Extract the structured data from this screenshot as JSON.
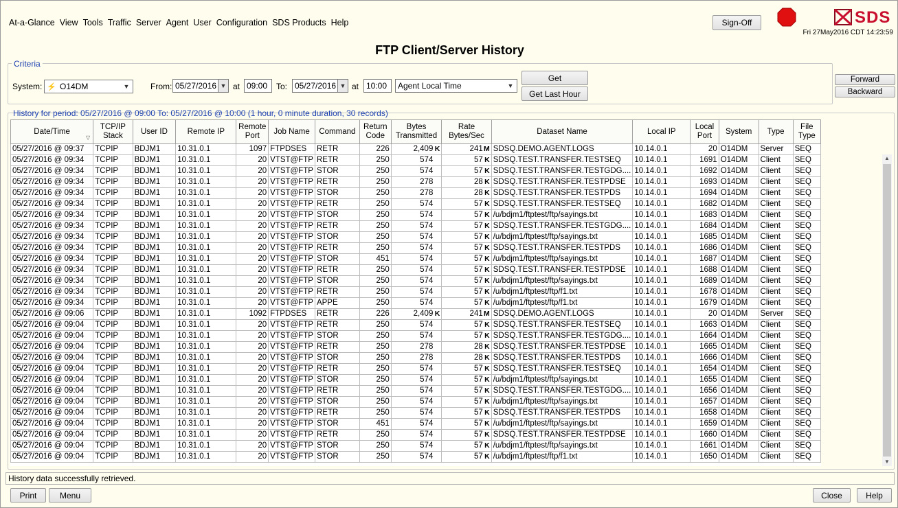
{
  "menu": [
    "At-a-Glance",
    "View",
    "Tools",
    "Traffic",
    "Server",
    "Agent",
    "User",
    "Configuration",
    "SDS Products",
    "Help"
  ],
  "sign_off": "Sign-Off",
  "logo_text": "SDS",
  "datetime": "Fri 27May2016 CDT 14:23:59",
  "page_title": "FTP Client/Server History",
  "criteria": {
    "legend": "Criteria",
    "system_label": "System:",
    "system_value": "O14DM",
    "from_label": "From:",
    "from_date": "05/27/2016",
    "at_label": "at",
    "from_time": "09:00",
    "to_label": "To:",
    "to_date": "05/27/2016",
    "to_time": "10:00",
    "timezone": "Agent Local Time",
    "get": "Get",
    "get_last_hour": "Get Last Hour"
  },
  "forward": "Forward",
  "backward": "Backward",
  "period_text": "History for period: 05/27/2016 @ 09:00 To: 05/27/2016 @ 10:00  (1 hour, 0 minute duration, 30 records)",
  "columns": [
    "Date/Time",
    "TCP/IP Stack",
    "User ID",
    "Remote IP",
    "Remote Port",
    "Job Name",
    "Command",
    "Return Code",
    "Bytes Transmitted",
    "Rate Bytes/Sec",
    "Dataset Name",
    "Local IP",
    "Local Port",
    "System",
    "Type",
    "File Type"
  ],
  "rows": [
    [
      "05/27/2016 @ 09:37",
      "TCPIP",
      "BDJM1",
      "10.31.0.1",
      "1097",
      "FTPDSES",
      "RETR",
      "226",
      "2,409",
      "K",
      "241",
      "M",
      "SDSQ.DEMO.AGENT.LOGS",
      "10.14.0.1",
      "20",
      "O14DM",
      "Server",
      "SEQ"
    ],
    [
      "05/27/2016 @ 09:34",
      "TCPIP",
      "BDJM1",
      "10.31.0.1",
      "20",
      "VTST@FTP",
      "RETR",
      "250",
      "574",
      "",
      "57",
      "K",
      "SDSQ.TEST.TRANSFER.TESTSEQ",
      "10.14.0.1",
      "1691",
      "O14DM",
      "Client",
      "SEQ"
    ],
    [
      "05/27/2016 @ 09:34",
      "TCPIP",
      "BDJM1",
      "10.31.0.1",
      "20",
      "VTST@FTP",
      "STOR",
      "250",
      "574",
      "",
      "57",
      "K",
      "SDSQ.TEST.TRANSFER.TESTGDG....",
      "10.14.0.1",
      "1692",
      "O14DM",
      "Client",
      "SEQ"
    ],
    [
      "05/27/2016 @ 09:34",
      "TCPIP",
      "BDJM1",
      "10.31.0.1",
      "20",
      "VTST@FTP",
      "RETR",
      "250",
      "278",
      "",
      "28",
      "K",
      "SDSQ.TEST.TRANSFER.TESTPDSE",
      "10.14.0.1",
      "1693",
      "O14DM",
      "Client",
      "SEQ"
    ],
    [
      "05/27/2016 @ 09:34",
      "TCPIP",
      "BDJM1",
      "10.31.0.1",
      "20",
      "VTST@FTP",
      "STOR",
      "250",
      "278",
      "",
      "28",
      "K",
      "SDSQ.TEST.TRANSFER.TESTPDS",
      "10.14.0.1",
      "1694",
      "O14DM",
      "Client",
      "SEQ"
    ],
    [
      "05/27/2016 @ 09:34",
      "TCPIP",
      "BDJM1",
      "10.31.0.1",
      "20",
      "VTST@FTP",
      "RETR",
      "250",
      "574",
      "",
      "57",
      "K",
      "SDSQ.TEST.TRANSFER.TESTSEQ",
      "10.14.0.1",
      "1682",
      "O14DM",
      "Client",
      "SEQ"
    ],
    [
      "05/27/2016 @ 09:34",
      "TCPIP",
      "BDJM1",
      "10.31.0.1",
      "20",
      "VTST@FTP",
      "STOR",
      "250",
      "574",
      "",
      "57",
      "K",
      "/u/bdjm1/ftptest/ftp/sayings.txt",
      "10.14.0.1",
      "1683",
      "O14DM",
      "Client",
      "SEQ"
    ],
    [
      "05/27/2016 @ 09:34",
      "TCPIP",
      "BDJM1",
      "10.31.0.1",
      "20",
      "VTST@FTP",
      "RETR",
      "250",
      "574",
      "",
      "57",
      "K",
      "SDSQ.TEST.TRANSFER.TESTGDG....",
      "10.14.0.1",
      "1684",
      "O14DM",
      "Client",
      "SEQ"
    ],
    [
      "05/27/2016 @ 09:34",
      "TCPIP",
      "BDJM1",
      "10.31.0.1",
      "20",
      "VTST@FTP",
      "STOR",
      "250",
      "574",
      "",
      "57",
      "K",
      "/u/bdjm1/ftptest/ftp/sayings.txt",
      "10.14.0.1",
      "1685",
      "O14DM",
      "Client",
      "SEQ"
    ],
    [
      "05/27/2016 @ 09:34",
      "TCPIP",
      "BDJM1",
      "10.31.0.1",
      "20",
      "VTST@FTP",
      "RETR",
      "250",
      "574",
      "",
      "57",
      "K",
      "SDSQ.TEST.TRANSFER.TESTPDS",
      "10.14.0.1",
      "1686",
      "O14DM",
      "Client",
      "SEQ"
    ],
    [
      "05/27/2016 @ 09:34",
      "TCPIP",
      "BDJM1",
      "10.31.0.1",
      "20",
      "VTST@FTP",
      "STOR",
      "451",
      "574",
      "",
      "57",
      "K",
      "/u/bdjm1/ftptest/ftp/sayings.txt",
      "10.14.0.1",
      "1687",
      "O14DM",
      "Client",
      "SEQ"
    ],
    [
      "05/27/2016 @ 09:34",
      "TCPIP",
      "BDJM1",
      "10.31.0.1",
      "20",
      "VTST@FTP",
      "RETR",
      "250",
      "574",
      "",
      "57",
      "K",
      "SDSQ.TEST.TRANSFER.TESTPDSE",
      "10.14.0.1",
      "1688",
      "O14DM",
      "Client",
      "SEQ"
    ],
    [
      "05/27/2016 @ 09:34",
      "TCPIP",
      "BDJM1",
      "10.31.0.1",
      "20",
      "VTST@FTP",
      "STOR",
      "250",
      "574",
      "",
      "57",
      "K",
      "/u/bdjm1/ftptest/ftp/sayings.txt",
      "10.14.0.1",
      "1689",
      "O14DM",
      "Client",
      "SEQ"
    ],
    [
      "05/27/2016 @ 09:34",
      "TCPIP",
      "BDJM1",
      "10.31.0.1",
      "20",
      "VTST@FTP",
      "RETR",
      "250",
      "574",
      "",
      "57",
      "K",
      "/u/bdjm1/ftptest/ftp/f1.txt",
      "10.14.0.1",
      "1678",
      "O14DM",
      "Client",
      "SEQ"
    ],
    [
      "05/27/2016 @ 09:34",
      "TCPIP",
      "BDJM1",
      "10.31.0.1",
      "20",
      "VTST@FTP",
      "APPE",
      "250",
      "574",
      "",
      "57",
      "K",
      "/u/bdjm1/ftptest/ftp/f1.txt",
      "10.14.0.1",
      "1679",
      "O14DM",
      "Client",
      "SEQ"
    ],
    [
      "05/27/2016 @ 09:06",
      "TCPIP",
      "BDJM1",
      "10.31.0.1",
      "1092",
      "FTPDSES",
      "RETR",
      "226",
      "2,409",
      "K",
      "241",
      "M",
      "SDSQ.DEMO.AGENT.LOGS",
      "10.14.0.1",
      "20",
      "O14DM",
      "Server",
      "SEQ"
    ],
    [
      "05/27/2016 @ 09:04",
      "TCPIP",
      "BDJM1",
      "10.31.0.1",
      "20",
      "VTST@FTP",
      "RETR",
      "250",
      "574",
      "",
      "57",
      "K",
      "SDSQ.TEST.TRANSFER.TESTSEQ",
      "10.14.0.1",
      "1663",
      "O14DM",
      "Client",
      "SEQ"
    ],
    [
      "05/27/2016 @ 09:04",
      "TCPIP",
      "BDJM1",
      "10.31.0.1",
      "20",
      "VTST@FTP",
      "STOR",
      "250",
      "574",
      "",
      "57",
      "K",
      "SDSQ.TEST.TRANSFER.TESTGDG....",
      "10.14.0.1",
      "1664",
      "O14DM",
      "Client",
      "SEQ"
    ],
    [
      "05/27/2016 @ 09:04",
      "TCPIP",
      "BDJM1",
      "10.31.0.1",
      "20",
      "VTST@FTP",
      "RETR",
      "250",
      "278",
      "",
      "28",
      "K",
      "SDSQ.TEST.TRANSFER.TESTPDSE",
      "10.14.0.1",
      "1665",
      "O14DM",
      "Client",
      "SEQ"
    ],
    [
      "05/27/2016 @ 09:04",
      "TCPIP",
      "BDJM1",
      "10.31.0.1",
      "20",
      "VTST@FTP",
      "STOR",
      "250",
      "278",
      "",
      "28",
      "K",
      "SDSQ.TEST.TRANSFER.TESTPDS",
      "10.14.0.1",
      "1666",
      "O14DM",
      "Client",
      "SEQ"
    ],
    [
      "05/27/2016 @ 09:04",
      "TCPIP",
      "BDJM1",
      "10.31.0.1",
      "20",
      "VTST@FTP",
      "RETR",
      "250",
      "574",
      "",
      "57",
      "K",
      "SDSQ.TEST.TRANSFER.TESTSEQ",
      "10.14.0.1",
      "1654",
      "O14DM",
      "Client",
      "SEQ"
    ],
    [
      "05/27/2016 @ 09:04",
      "TCPIP",
      "BDJM1",
      "10.31.0.1",
      "20",
      "VTST@FTP",
      "STOR",
      "250",
      "574",
      "",
      "57",
      "K",
      "/u/bdjm1/ftptest/ftp/sayings.txt",
      "10.14.0.1",
      "1655",
      "O14DM",
      "Client",
      "SEQ"
    ],
    [
      "05/27/2016 @ 09:04",
      "TCPIP",
      "BDJM1",
      "10.31.0.1",
      "20",
      "VTST@FTP",
      "RETR",
      "250",
      "574",
      "",
      "57",
      "K",
      "SDSQ.TEST.TRANSFER.TESTGDG....",
      "10.14.0.1",
      "1656",
      "O14DM",
      "Client",
      "SEQ"
    ],
    [
      "05/27/2016 @ 09:04",
      "TCPIP",
      "BDJM1",
      "10.31.0.1",
      "20",
      "VTST@FTP",
      "STOR",
      "250",
      "574",
      "",
      "57",
      "K",
      "/u/bdjm1/ftptest/ftp/sayings.txt",
      "10.14.0.1",
      "1657",
      "O14DM",
      "Client",
      "SEQ"
    ],
    [
      "05/27/2016 @ 09:04",
      "TCPIP",
      "BDJM1",
      "10.31.0.1",
      "20",
      "VTST@FTP",
      "RETR",
      "250",
      "574",
      "",
      "57",
      "K",
      "SDSQ.TEST.TRANSFER.TESTPDS",
      "10.14.0.1",
      "1658",
      "O14DM",
      "Client",
      "SEQ"
    ],
    [
      "05/27/2016 @ 09:04",
      "TCPIP",
      "BDJM1",
      "10.31.0.1",
      "20",
      "VTST@FTP",
      "STOR",
      "451",
      "574",
      "",
      "57",
      "K",
      "/u/bdjm1/ftptest/ftp/sayings.txt",
      "10.14.0.1",
      "1659",
      "O14DM",
      "Client",
      "SEQ"
    ],
    [
      "05/27/2016 @ 09:04",
      "TCPIP",
      "BDJM1",
      "10.31.0.1",
      "20",
      "VTST@FTP",
      "RETR",
      "250",
      "574",
      "",
      "57",
      "K",
      "SDSQ.TEST.TRANSFER.TESTPDSE",
      "10.14.0.1",
      "1660",
      "O14DM",
      "Client",
      "SEQ"
    ],
    [
      "05/27/2016 @ 09:04",
      "TCPIP",
      "BDJM1",
      "10.31.0.1",
      "20",
      "VTST@FTP",
      "STOR",
      "250",
      "574",
      "",
      "57",
      "K",
      "/u/bdjm1/ftptest/ftp/sayings.txt",
      "10.14.0.1",
      "1661",
      "O14DM",
      "Client",
      "SEQ"
    ],
    [
      "05/27/2016 @ 09:04",
      "TCPIP",
      "BDJM1",
      "10.31.0.1",
      "20",
      "VTST@FTP",
      "STOR",
      "250",
      "574",
      "",
      "57",
      "K",
      "/u/bdjm1/ftptest/ftp/f1.txt",
      "10.14.0.1",
      "1650",
      "O14DM",
      "Client",
      "SEQ"
    ]
  ],
  "status_text": "History data successfully retrieved.",
  "footer": {
    "print": "Print",
    "menu": "Menu",
    "close": "Close",
    "help": "Help"
  },
  "icons": {
    "stop": "stop-sign-icon",
    "logo": "sds-logo-icon",
    "system": "lightning-icon",
    "sort": "sort-icon"
  },
  "colors": {
    "background": "#fffdee",
    "legend": "#1a3fb0",
    "stop": "#e01010",
    "logo": "#c8102e"
  }
}
